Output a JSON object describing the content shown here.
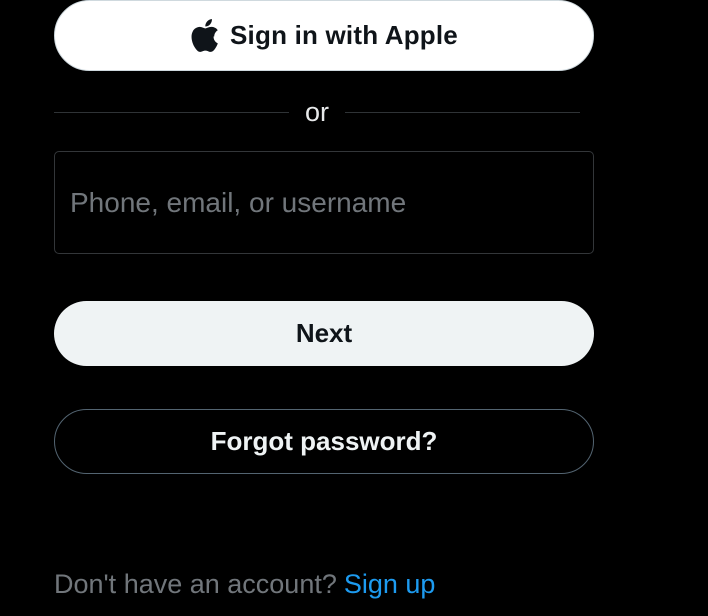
{
  "apple_button": {
    "icon": "apple-logo-icon",
    "label": "Sign in with Apple"
  },
  "divider": {
    "text": "or"
  },
  "login_input": {
    "placeholder": "Phone, email, or username",
    "value": ""
  },
  "next_button": {
    "label": "Next"
  },
  "forgot_button": {
    "label": "Forgot password?"
  },
  "signup": {
    "prompt": "Don't have an account?",
    "link": "Sign up"
  },
  "colors": {
    "background": "#000000",
    "primary_button": "#eff3f4",
    "link": "#1d9bf0",
    "muted_text": "#71767b"
  }
}
